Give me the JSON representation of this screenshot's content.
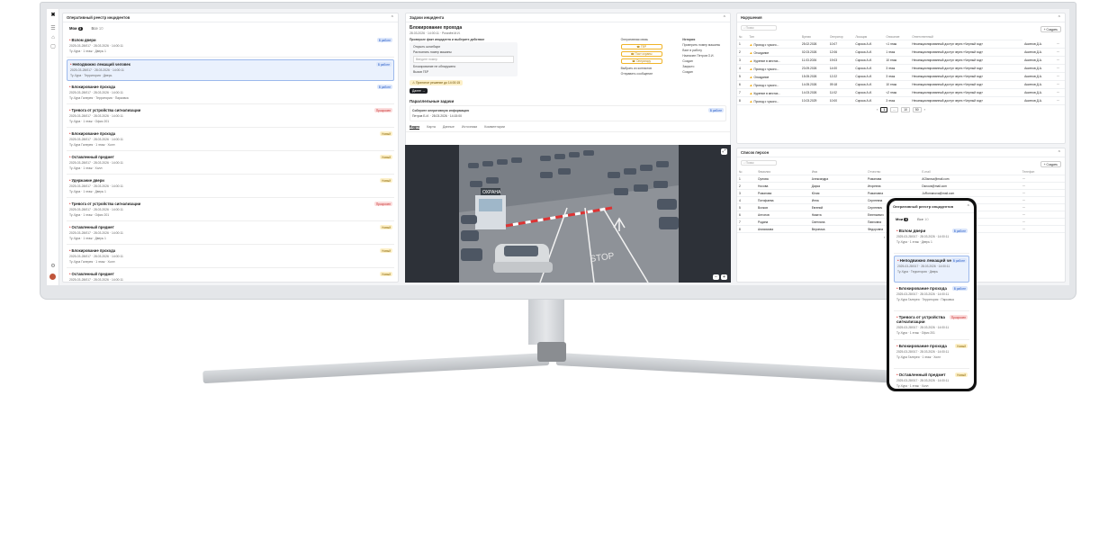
{
  "incidents_panel": {
    "title": "Оперативный реестр инцидентов",
    "tab_mine": "Мои",
    "tab_mine_count": "3",
    "tab_all": "Все",
    "tab_all_count": "10",
    "items": [
      {
        "title": "Взлом двери",
        "meta": "2025-03-28/017 · 28.03.2026 · 14:00:11",
        "loc": "Ту-Хура · 1 этаж · Дверь 1",
        "badge": "В работе",
        "kind": "work"
      },
      {
        "title": "Неподвижно лежащий человек",
        "meta": "2025-03-28/017 · 28.03.2026 · 14:00:11",
        "loc": "Ту-Хура · Территория · Дверь",
        "badge": "В работе",
        "kind": "work"
      },
      {
        "title": "Блокирование прохода",
        "meta": "2025-03-28/017 · 28.03.2026 · 14:00:11",
        "loc": "Ту-Хура Галерея · Территория · Парковка",
        "badge": "В работе",
        "kind": "work"
      },
      {
        "title": "Тревога от устройства сигнализации",
        "meta": "2025-03-28/017 · 28.03.2026 · 14:00:11",
        "loc": "Ту-Хура · 1 этаж · Офис 201",
        "badge": "Просрочен",
        "kind": "over"
      },
      {
        "title": "Блокирование прохода",
        "meta": "2025-03-28/017 · 28.03.2026 · 14:00:11",
        "loc": "Ту-Хура Галерея · 1 этаж · Холл",
        "badge": "Новый",
        "kind": "new"
      },
      {
        "title": "Оставленный предмет",
        "meta": "2025-03-28/017 · 28.03.2026 · 14:00:11",
        "loc": "Ту-Хура · 1 этаж · Холл",
        "badge": "Новый",
        "kind": "new"
      },
      {
        "title": "Удержание двери",
        "meta": "2025-03-28/017 · 28.03.2026 · 14:00:11",
        "loc": "Ту-Хура · 1 этаж · Дверь 1",
        "badge": "Новый",
        "kind": "new"
      },
      {
        "title": "Тревога от устройства сигнализации",
        "meta": "2025-03-28/017 · 28.03.2026 · 14:00:11",
        "loc": "Ту-Хура · 1 этаж · Офис 201",
        "badge": "Просрочен",
        "kind": "over"
      },
      {
        "title": "Оставленный предмет",
        "meta": "2025-03-28/017 · 28.03.2026 · 14:00:11",
        "loc": "Ту-Хура · 1 этаж · Дверь 1",
        "badge": "Новый",
        "kind": "new"
      },
      {
        "title": "Блокирование прохода",
        "meta": "2025-03-28/017 · 28.03.2026 · 14:00:11",
        "loc": "Ту-Хура Галерея · 1 этаж · Холл",
        "badge": "Новый",
        "kind": "new"
      },
      {
        "title": "Оставленный предмет",
        "meta": "2025-03-28/017 · 28.03.2026 · 14:00:11",
        "loc": "Ту-Хура · 1 этаж · Холл",
        "badge": "Новый",
        "kind": "new"
      }
    ]
  },
  "task_panel": {
    "title": "Задачи инцидента",
    "heading": "Блокирование прохода",
    "meta": "28.03.2026 · 14:00:11 · Рогачёв М.И.",
    "checks_title": "Проверьте факт инцидента и выберите действие",
    "actions": [
      "Открыть шлагбаум",
      "Распознать номер машины",
      "Введите номер",
      "Блокирование не обнаружено",
      "Вызов ГБР"
    ],
    "ops_title": "Оперативная связь",
    "ops_buttons": [
      "ГБР",
      "Пост охраны",
      "Оператору"
    ],
    "ops_links": [
      "Выбрать из контактов",
      "Отправить сообщение"
    ],
    "log_title": "История",
    "log_items": [
      "Проверить номер машины",
      "Взят в работу",
      "Назначен Петров О.И.",
      "Создан",
      "Закрыто",
      "Создан"
    ],
    "warning": "Принятое решение до 14:00:15",
    "next_button": "Далее",
    "parallel_title": "Параллельные задачи",
    "parallel_task": "Соберите оперативную информацию",
    "parallel_meta": "Петров Б.И. · 28.03.2026 · 14:15:00",
    "parallel_badge": "В работе",
    "video_tabs": [
      "Видео",
      "Карта",
      "Данные",
      "Источники",
      "Комментарии"
    ],
    "video_zoom_minus": "−",
    "video_zoom_plus": "+",
    "video_sign": "ОХРАНА",
    "video_stop": "STOP"
  },
  "violations": {
    "title": "Нарушения",
    "search": "Поиск",
    "create": "+ Создать",
    "columns": [
      "№",
      "Тип",
      "Время",
      "Оператор",
      "Локация",
      "Описание",
      "Ответственный"
    ],
    "rows": [
      [
        "1",
        "Проход с чужого...",
        "25.02.2026",
        "10:07",
        "Сорока А.И.",
        "<1 этаж",
        "Несанкционированный доступ через «Черный ход»",
        "Аксенов Д.А."
      ],
      [
        "2",
        "Отсидание",
        "02.03.2026",
        "12:06",
        "Сорока А.И.",
        "1 этаж",
        "Несанкционированный доступ через «Черный ход»",
        "Аксенов Д.А."
      ],
      [
        "3",
        "Курение в местах...",
        "11.03.2026",
        "19:03",
        "Сорока А.И.",
        "10 этаж",
        "Несанкционированный доступ через «Черный ход»",
        "Аксенов Д.А."
      ],
      [
        "4",
        "Проход с чужого...",
        "23.09.2026",
        "14:00",
        "Сорока А.И.",
        "3 этаж",
        "Несанкционированный доступ через «Черный ход»",
        "Аксенов Д.А."
      ],
      [
        "5",
        "Опоздание",
        "15.05.2026",
        "12:22",
        "Сорока А.И.",
        "3 этаж",
        "Несанкционированный доступ через «Черный ход»",
        "Аксенов Д.А."
      ],
      [
        "6",
        "Проход с чужого...",
        "14.05.2026",
        "09:18",
        "Сорока А.И.",
        "10 этаж",
        "Несанкционированный доступ через «Черный ход»",
        "Аксенов Д.А."
      ],
      [
        "7",
        "Курение в местах...",
        "14.03.2026",
        "11:02",
        "Сорока А.И.",
        "<2 этаж",
        "Несанкционированный доступ через «Черный ход»",
        "Аксенов Д.А."
      ],
      [
        "8",
        "Проход с чужого...",
        "10.03.2029",
        "10:00",
        "Сорока А.И.",
        "3 этаж",
        "Несанкционированный доступ через «Черный ход»",
        "Аксенов Д.А."
      ]
    ],
    "pager": [
      "1",
      "...",
      "10",
      "50"
    ]
  },
  "persons": {
    "title": "Список персон",
    "search": "Поиск",
    "create": "+ Создать",
    "columns": [
      "№",
      "Фамилия",
      "Имя",
      "Отчество",
      "E-mail",
      "Телефон"
    ],
    "rows": [
      [
        "1",
        "Орлова",
        "Александра",
        "Романова",
        "AOlarova@mail.com"
      ],
      [
        "2",
        "Носова",
        "Дарья",
        "Игоревна",
        "Dsnova@mail.com"
      ],
      [
        "3",
        "Романова",
        "Юлия",
        "Романовна",
        "JuRomanova@mail.com"
      ],
      [
        "4",
        "Потифаева",
        "Инна",
        "Сергеевна",
        "INikolfova@mail.com"
      ],
      [
        "5",
        "Волков",
        "Евгений",
        "Сергеевич",
        "EvVolkov@mail.com"
      ],
      [
        "6",
        "Антонов",
        "Никита",
        "Евгеньевич",
        "AnAntonov@mail.com"
      ],
      [
        "7",
        "Родина",
        "Светлана",
        "Павловна",
        "SvRodina@mail.com"
      ],
      [
        "8",
        "Анисимова",
        "Вероника",
        "Федоровна",
        "VeAnisimova@mail.com"
      ]
    ],
    "pager": [
      "1",
      "2",
      "3"
    ]
  },
  "phone": {
    "title": "Оперативный реестр инцидентов",
    "tab_mine": "Мои",
    "tab_mine_count": "3",
    "tab_all": "Все",
    "tab_all_count": "10",
    "items": [
      {
        "title": "Взлом двери",
        "meta": "2025-03-28/017 · 28.03.2026 · 14:00:11",
        "loc": "Ту-Хура · 1 этаж · Дверь 1",
        "badge": "В работе",
        "kind": "work"
      },
      {
        "title": "Неподвижно лежащий человек",
        "meta": "2025-03-28/017 · 28.03.2026 · 14:00:11",
        "loc": "Ту-Хура · Территория · Дверь",
        "badge": "В работе",
        "kind": "work"
      },
      {
        "title": "Блокирование прохода",
        "meta": "2025-03-28/017 · 28.03.2026 · 14:00:11",
        "loc": "Ту-Хура Галерея · Территория · Парковка",
        "badge": "В работе",
        "kind": "work"
      },
      {
        "title": "Тревога от устройства сигнализации",
        "meta": "2025-03-28/017 · 28.03.2026 · 14:00:11",
        "loc": "Ту-Хура · 1 этаж · Офис 201",
        "badge": "Просрочен",
        "kind": "over"
      },
      {
        "title": "Блокирование прохода",
        "meta": "2025-03-28/017 · 28.03.2026 · 14:00:11",
        "loc": "Ту-Хура Галерея · 1 этаж · Холл",
        "badge": "Новый",
        "kind": "new"
      },
      {
        "title": "Оставленный предмет",
        "meta": "2025-03-28/017 · 28.03.2026 · 14:00:11",
        "loc": "Ту-Хура · 1 этаж · Холл",
        "badge": "Новый",
        "kind": "new"
      }
    ]
  }
}
